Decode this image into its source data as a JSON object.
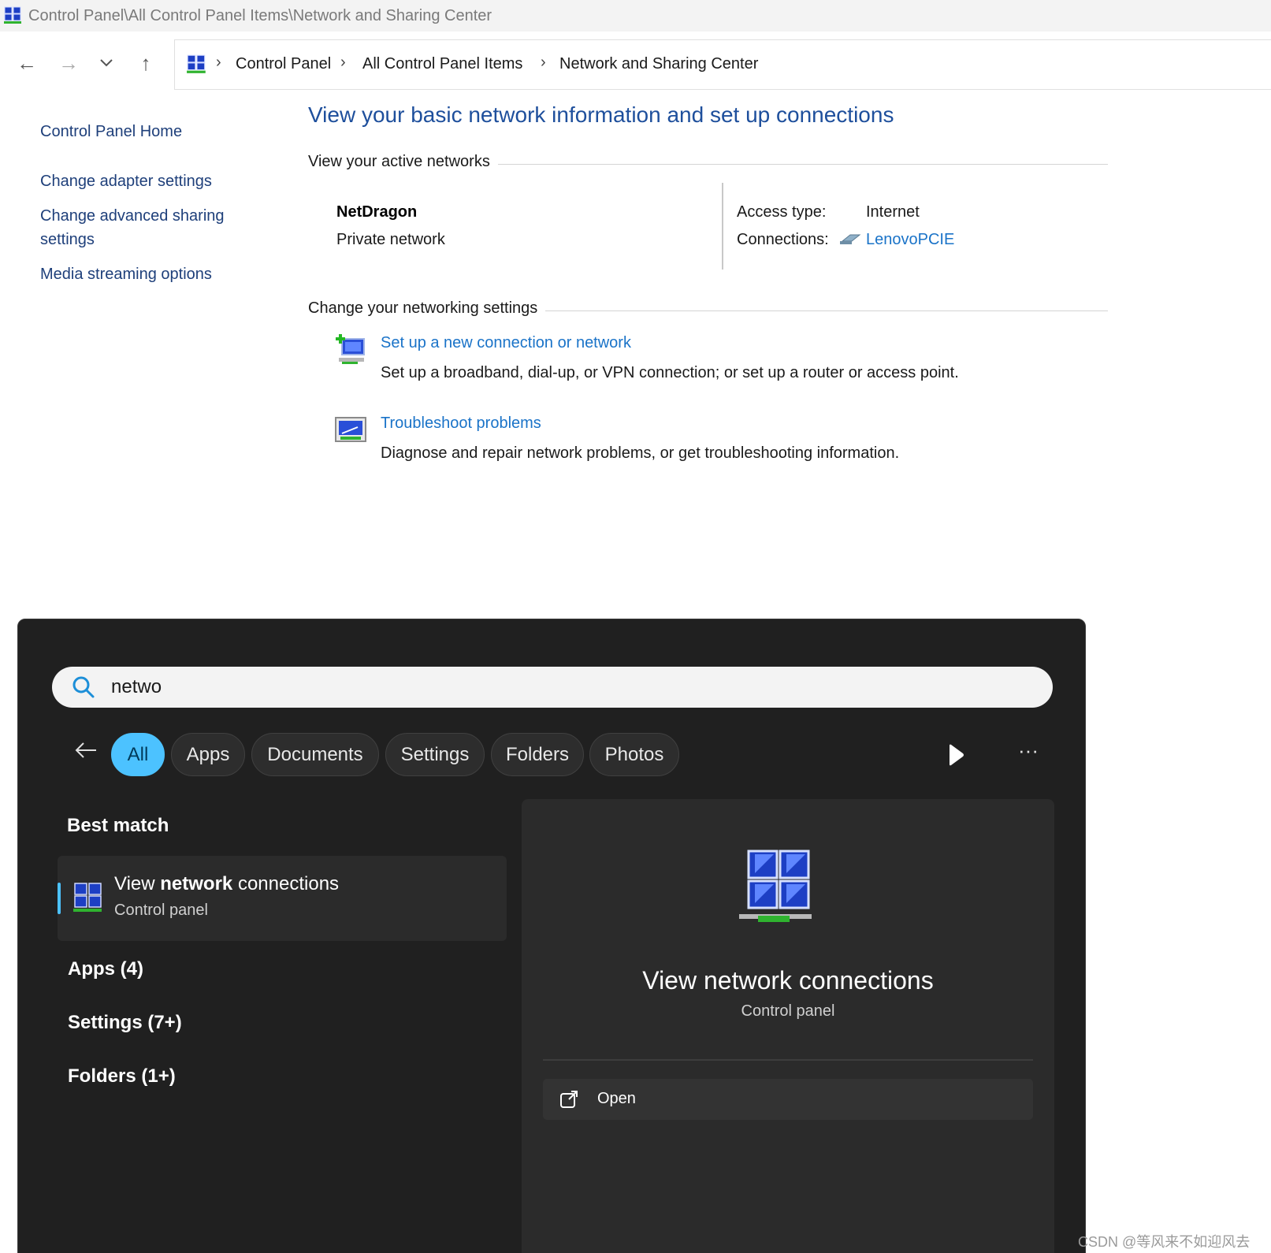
{
  "window": {
    "title": "Control Panel\\All Control Panel Items\\Network and Sharing Center"
  },
  "address_bar": {
    "breadcrumbs": [
      "Control Panel",
      "All Control Panel Items",
      "Network and Sharing Center"
    ],
    "separator": "›"
  },
  "nav_buttons": {
    "back": "←",
    "forward": "→",
    "recent": "⌄",
    "up": "↑"
  },
  "left_nav": {
    "home": "Control Panel Home",
    "links": [
      "Change adapter settings",
      "Change advanced sharing",
      "settings",
      "Media streaming options"
    ]
  },
  "main": {
    "title": "View your basic network information and set up connections",
    "active_networks_head": "View your active networks",
    "network": {
      "name": "NetDragon",
      "category": "Private network",
      "access_type_label": "Access type:",
      "access_type_value": "Internet",
      "connections_label": "Connections:",
      "connections_value": "LenovoPCIE"
    },
    "change_settings_head": "Change your networking settings",
    "tasks": [
      {
        "link": "Set up a new connection or network",
        "desc": "Set up a broadband, dial-up, or VPN connection; or set up a router or access point.",
        "icon": "new-connection-icon"
      },
      {
        "link": "Troubleshoot problems",
        "desc": "Diagnose and repair network problems, or get troubleshooting information.",
        "icon": "troubleshoot-icon"
      }
    ]
  },
  "search": {
    "query": "netwo",
    "filters": [
      "All",
      "Apps",
      "Documents",
      "Settings",
      "Folders",
      "Photos"
    ],
    "active_filter": "All",
    "best_match_head": "Best match",
    "best_match": {
      "title_pre": "View ",
      "title_bold": "network",
      "title_post": " connections",
      "subtitle": "Control panel"
    },
    "categories": [
      "Apps (4)",
      "Settings (7+)",
      "Folders (1+)"
    ],
    "detail": {
      "title": "View network connections",
      "subtitle": "Control panel",
      "open_label": "Open"
    },
    "more": "···"
  },
  "watermark": "CSDN @等风来不如迎风去",
  "colors": {
    "link_blue": "#1a73c8",
    "title_blue": "#1e4f9c",
    "accent": "#4cc2ff",
    "panel_bg": "#202020"
  }
}
